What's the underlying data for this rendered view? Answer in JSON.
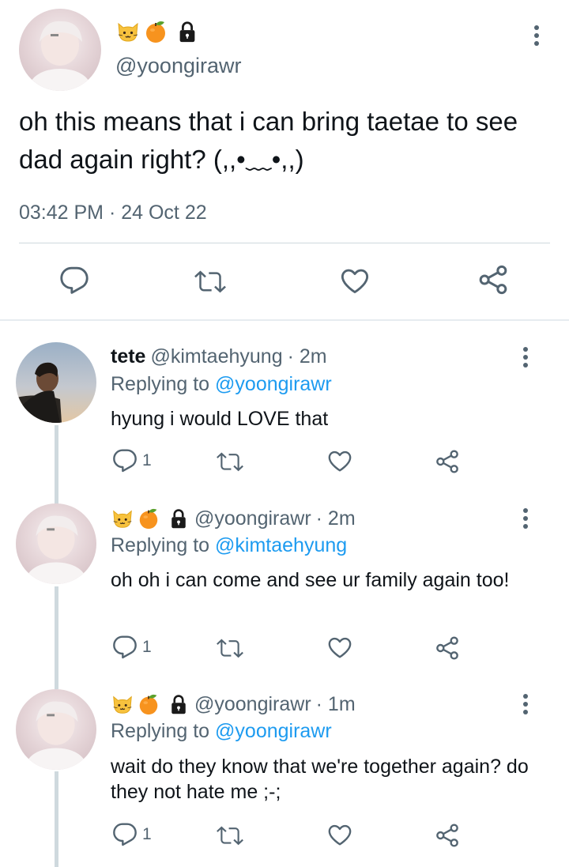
{
  "main_tweet": {
    "handle": "@yoongirawr",
    "text": "oh this means that i can bring taetae to see dad again right? (,,•﹏•,,)",
    "timestamp": "03:42 PM · 24 Oct 22",
    "icons": [
      "cat-face-icon",
      "tangerine-icon",
      "lock-icon",
      "more-options-icon",
      "reply-icon",
      "retweet-icon",
      "like-icon",
      "share-icon"
    ]
  },
  "replies": [
    {
      "display_name": "tete",
      "handle": "@kimtaehyung",
      "time": "· 2m",
      "replying_prefix": "Replying to",
      "replying_to": "@yoongirawr",
      "text": "hyung i would LOVE that",
      "reply_count": "1"
    },
    {
      "display_name": "",
      "handle": "@yoongirawr",
      "time": "· 2m",
      "replying_prefix": "Replying to",
      "replying_to": "@kimtaehyung",
      "text": "oh oh i can come and see ur family again too!",
      "reply_count": "1"
    },
    {
      "display_name": "",
      "handle": "@yoongirawr",
      "time": "· 1m",
      "replying_prefix": "Replying to",
      "replying_to": "@yoongirawr",
      "text": "wait do they know that we're together again? do they not hate me ;-;",
      "reply_count": "1"
    }
  ],
  "colors": {
    "link": "#1d9bf0",
    "muted": "#536471",
    "text": "#0f1419",
    "divider": "#cfd9de"
  }
}
